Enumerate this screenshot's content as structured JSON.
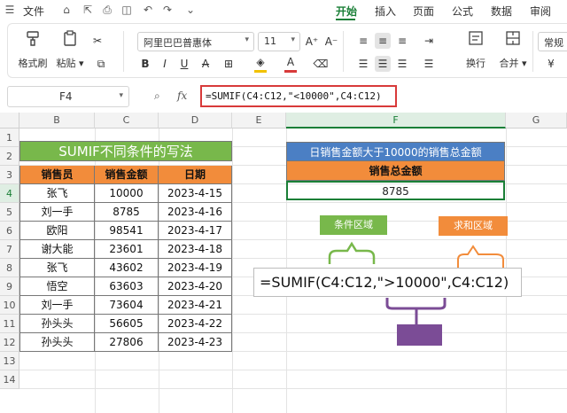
{
  "menubar": {
    "file_label": "文件",
    "tabs": [
      {
        "label": "开始",
        "active": true
      },
      {
        "label": "插入",
        "active": false
      },
      {
        "label": "页面",
        "active": false
      },
      {
        "label": "公式",
        "active": false
      },
      {
        "label": "数据",
        "active": false
      },
      {
        "label": "审阅",
        "active": false
      }
    ],
    "icons": [
      "menu-icon",
      "home-icon",
      "export-icon",
      "print-icon",
      "preview-icon",
      "undo-icon",
      "redo-icon",
      "more-icon"
    ]
  },
  "ribbon": {
    "format_painter_label": "格式刷",
    "paste_label": "粘贴",
    "font_name": "阿里巴巴普惠体",
    "font_size": "11",
    "wrap_label": "换行",
    "merge_label": "合并",
    "style_label": "常规",
    "fill_color": "#f2c200",
    "font_color": "#d83a3a"
  },
  "formula_bar": {
    "cell_ref": "F4",
    "fx_label": "fx",
    "formula": "=SUMIF(C4:C12,\"<10000\",C4:C12)"
  },
  "columns": [
    "B",
    "C",
    "D",
    "E",
    "F",
    "G"
  ],
  "rows": [
    "1",
    "2",
    "3",
    "4",
    "5",
    "6",
    "7",
    "8",
    "9",
    "10",
    "11",
    "12",
    "13",
    "14"
  ],
  "table": {
    "title": "SUMIF不同条件的写法",
    "headers": [
      "销售员",
      "销售金额",
      "日期"
    ],
    "rows": [
      [
        "张飞",
        "10000",
        "2023-4-15"
      ],
      [
        "刘一手",
        "8785",
        "2023-4-16"
      ],
      [
        "欧阳",
        "98541",
        "2023-4-17"
      ],
      [
        "谢大能",
        "23601",
        "2023-4-18"
      ],
      [
        "张飞",
        "43602",
        "2023-4-19"
      ],
      [
        "悟空",
        "63603",
        "2023-4-20"
      ],
      [
        "刘一手",
        "73604",
        "2023-4-21"
      ],
      [
        "孙头头",
        "56605",
        "2023-4-22"
      ],
      [
        "孙头头",
        "27806",
        "2023-4-23"
      ]
    ]
  },
  "summary": {
    "title": "日销售金额大于10000的销售总金额",
    "header": "销售总金额",
    "value": "8785"
  },
  "annotation": {
    "condition_label": "条件区域",
    "sum_label": "求和区域",
    "formula": "=SUMIF(C4:C12,\">10000\",C4:C12)"
  },
  "colors": {
    "accent_green": "#1a7f37",
    "banner_green": "#78b84b",
    "header_orange": "#f28c3b",
    "banner_blue": "#4b7fc4",
    "highlight_red": "#d83a3a",
    "purple": "#7b4c96"
  }
}
